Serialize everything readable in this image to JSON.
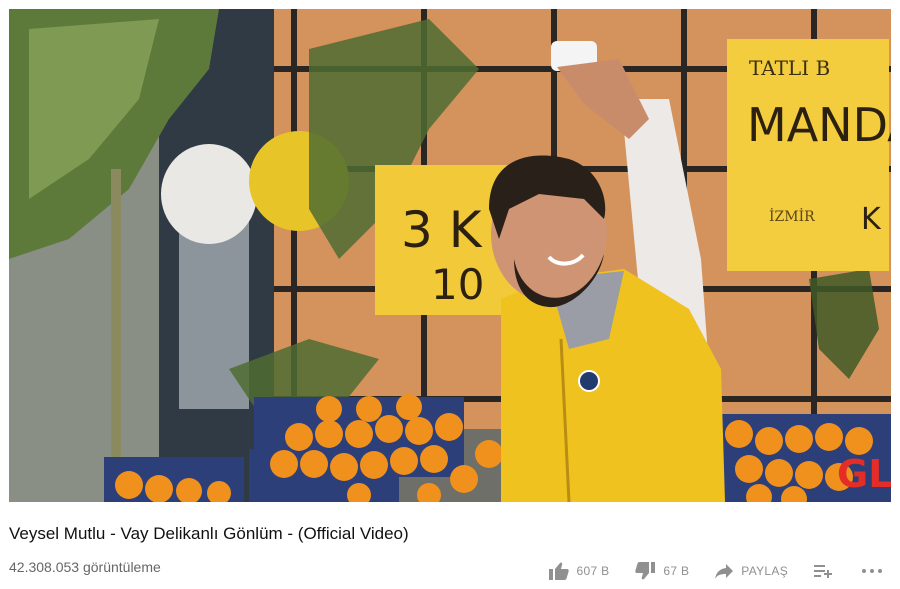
{
  "video": {
    "title": "Veysel Mutlu - Vay Delikanlı Gönlüm - (Official Video)",
    "views": "42.308.053 görüntüleme",
    "scene": {
      "sign_small_top": "TATLI B",
      "sign_main": "MANDA",
      "sign_price_1": "3 K",
      "sign_price_2": "10",
      "sign_izmir": "İZMİR",
      "sign_k": "K",
      "channel_logo": "GL"
    }
  },
  "actions": {
    "like_count": "607 B",
    "dislike_count": "67 B",
    "share_label": "PAYLAŞ"
  },
  "colors": {
    "accent_red": "#e52d27",
    "icon_gray": "#909090"
  },
  "icons": [
    "thumbs-up-icon",
    "thumbs-down-icon",
    "share-arrow-icon",
    "add-to-playlist-icon",
    "more-icon"
  ]
}
